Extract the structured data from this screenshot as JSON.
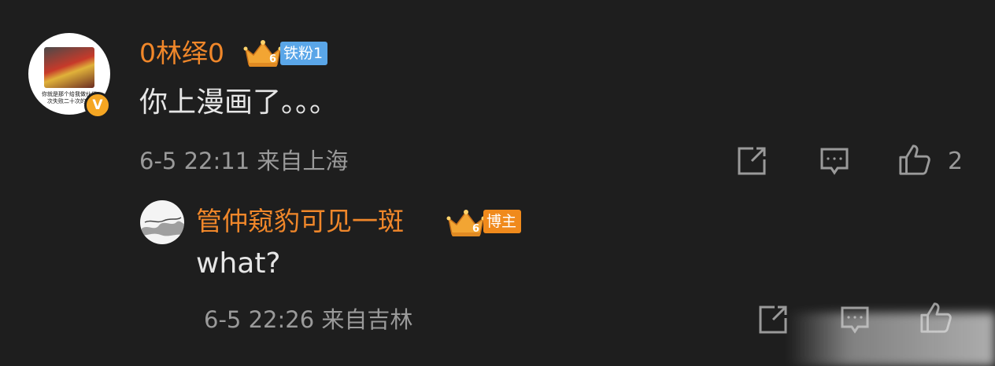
{
  "comment": {
    "username": "0林绎0",
    "avatar_caption": "你就是那个给我做伙伴\n次失败二十次的损",
    "verified_mark": "V",
    "crown_level": "6",
    "fan_badge": "铁粉1",
    "text": "你上漫画了。。。",
    "date": "6-5 22:11",
    "location": "来自上海",
    "like_count": "2",
    "icons": [
      "share-icon",
      "comment-icon",
      "like-icon"
    ]
  },
  "reply": {
    "username": "管仲窥豹可见一斑",
    "crown_level": "6",
    "role_badge": "博主",
    "text": "what?",
    "date": "6-5 22:26",
    "location": "来自吉林",
    "icons": [
      "share-icon",
      "comment-icon",
      "like-icon"
    ]
  },
  "colors": {
    "background": "#1e1e1e",
    "username": "#f0872a",
    "text": "#e6e6e6",
    "meta": "#9a9a9a",
    "fan_badge": "#5aa6e8",
    "blogger_badge": "#f08a1c",
    "verified": "#f5a623"
  }
}
